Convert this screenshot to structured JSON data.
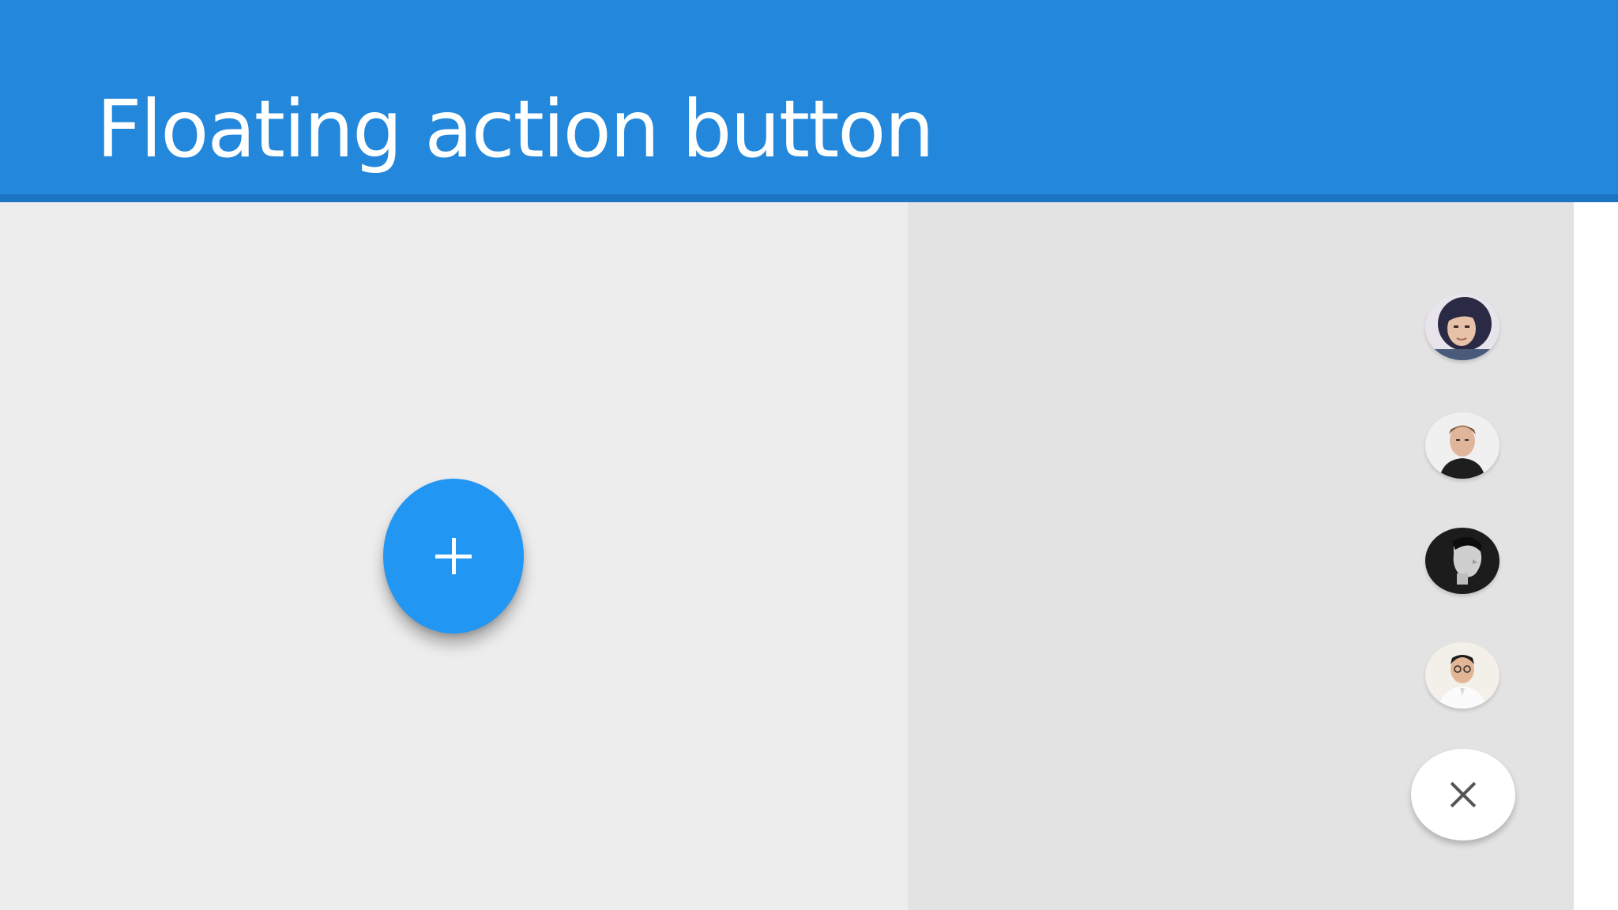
{
  "header": {
    "title": "Floating action button",
    "background_color": "#2388dc"
  },
  "panels": {
    "left_background": "#eeedee",
    "right_background": "#e4e3e4"
  },
  "main_fab": {
    "icon": "plus-icon",
    "color": "#2196f3"
  },
  "speed_dial": {
    "avatars": [
      {
        "name": "avatar-woman-dark-hair"
      },
      {
        "name": "avatar-man-short-hair"
      },
      {
        "name": "avatar-man-profile-dark"
      },
      {
        "name": "avatar-man-glasses-white-shirt"
      }
    ],
    "close_button": {
      "icon": "close-icon",
      "color": "#ffffff"
    }
  }
}
